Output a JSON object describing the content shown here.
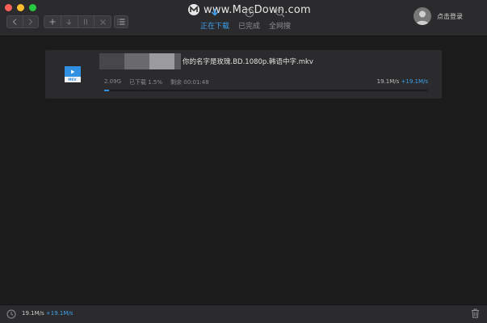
{
  "window": {
    "watermark": "www.MacDown.com"
  },
  "toolbar": {
    "tabs": [
      {
        "label": "正在下载",
        "icon": "download-icon",
        "active": true
      },
      {
        "label": "已完成",
        "icon": "clock-icon",
        "active": false
      },
      {
        "label": "全网搜",
        "icon": "search-icon",
        "active": false
      }
    ],
    "login_label": "点击登录"
  },
  "download": {
    "file_type": "MKV",
    "filename": "你的名字是玫瑰.BD.1080p.韩语中字.mkv",
    "size": "2.09G",
    "downloaded": "已下载 1.5%",
    "remaining": "剩余 00:01:48",
    "progress": 0.015,
    "speed_down": "19.1M/s",
    "speed_up": "+19.1M/s"
  },
  "statusbar": {
    "speed_down": "19.1M/s",
    "speed_up": "+19.1M/s"
  },
  "colors": {
    "accent": "#3ba2f0",
    "background": "#1b1b1c",
    "panel": "#2b2b2d"
  }
}
